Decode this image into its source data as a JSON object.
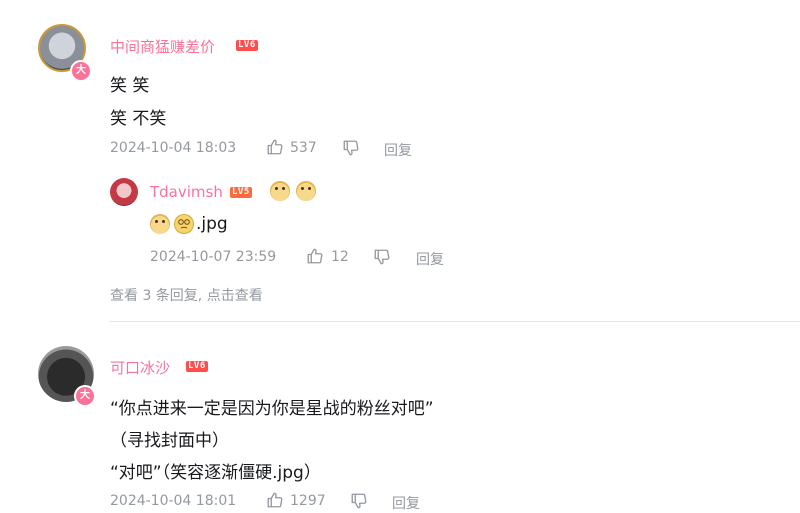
{
  "comments": [
    {
      "username": "中间商猛赚差价",
      "level": "LV6",
      "badge": "大",
      "lines": [
        "笑 笑",
        "笑 不笑"
      ],
      "time": "2024-10-04 18:03",
      "likes": "537",
      "reply_label": "回复",
      "replies": [
        {
          "username": "Tdavimsh",
          "level": "LV5",
          "name_emojis": [
            "doge-emoji",
            "doge-emoji"
          ],
          "text": ".jpg",
          "text_emojis": [
            "doge-emoji",
            "dazed-emoji"
          ],
          "time": "2024-10-07 23:59",
          "likes": "12",
          "reply_label": "回复"
        }
      ],
      "view_more": "查看 3 条回复, 点击查看"
    },
    {
      "username": "可口冰沙",
      "level": "LV6",
      "badge": "大",
      "lines": [
        "“你点进来一定是因为你是星战的粉丝对吧”",
        "（寻找封面中）",
        "“对吧”（笑容逐渐僵硬.jpg）"
      ],
      "time": "2024-10-04 18:01",
      "likes": "1297",
      "reply_label": "回复"
    }
  ],
  "colors": {
    "username": "#fb7299",
    "meta": "#9499a0",
    "text": "#18191c",
    "lv6": "#ff4d4d",
    "lv5": "#ff6a3d"
  }
}
